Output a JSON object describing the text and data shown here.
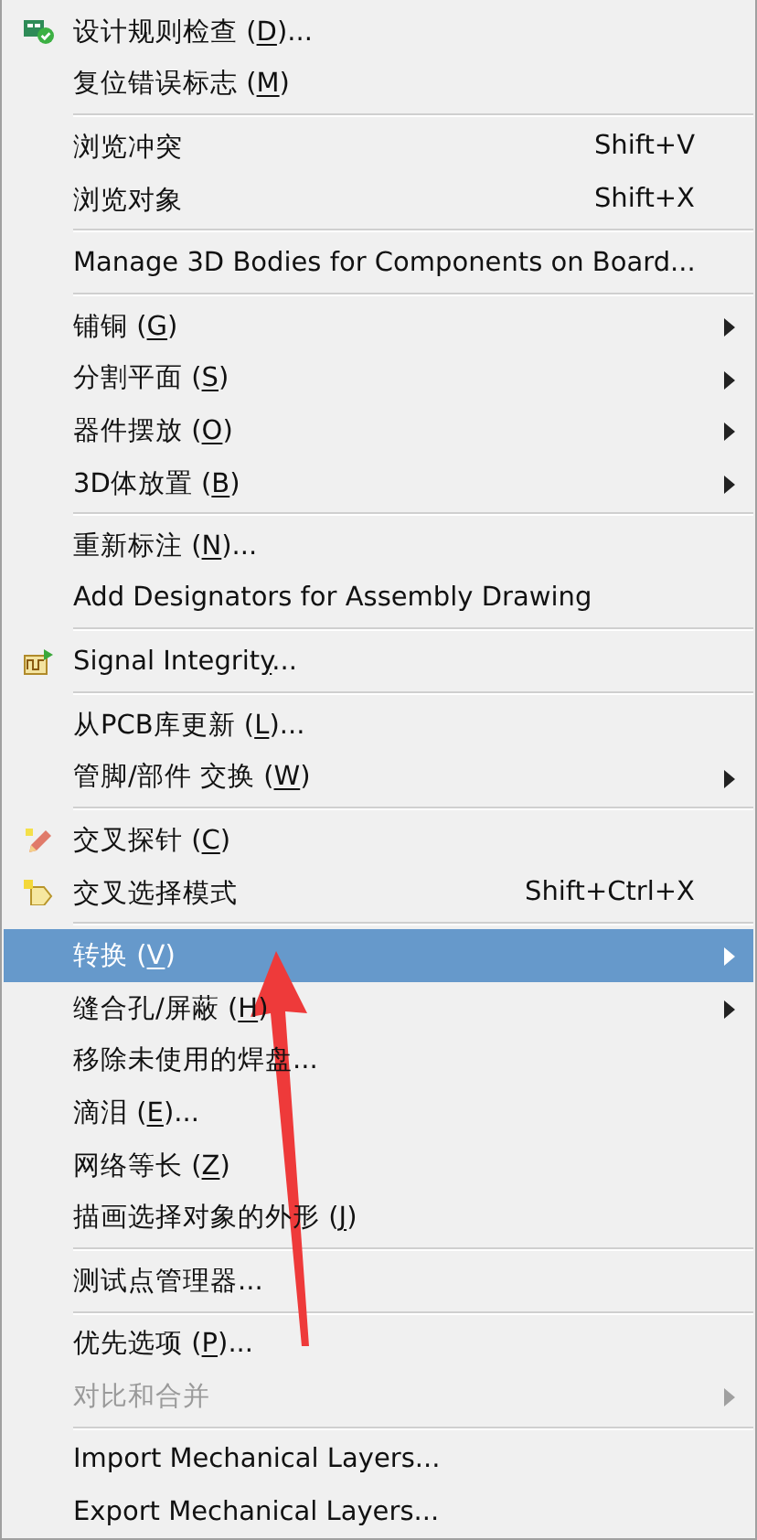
{
  "menu": {
    "groups": [
      [
        {
          "label": "设计规则检查 (",
          "key": "D",
          "rest": ")...",
          "kind": "check",
          "selected": false,
          "disabled": false,
          "submenu": false
        },
        {
          "label": "复位错误标志 (",
          "key": "M",
          "rest": ")",
          "selected": false,
          "disabled": false,
          "submenu": false
        }
      ],
      [
        {
          "label": "浏览冲突",
          "shortcut": "Shift+V",
          "selected": false,
          "disabled": false,
          "submenu": false
        },
        {
          "label": "浏览对象",
          "shortcut": "Shift+X",
          "selected": false,
          "disabled": false,
          "submenu": false
        }
      ],
      [
        {
          "label": "Manage 3D Bodies for Components on Board...",
          "selected": false,
          "disabled": false,
          "submenu": false
        }
      ],
      [
        {
          "label": "铺铜 (",
          "key": "G",
          "rest": ")",
          "selected": false,
          "disabled": false,
          "submenu": true
        },
        {
          "label": "分割平面 (",
          "key": "S",
          "rest": ")",
          "selected": false,
          "disabled": false,
          "submenu": true
        },
        {
          "label": "器件摆放 (",
          "key": "O",
          "rest": ")",
          "selected": false,
          "disabled": false,
          "submenu": true
        },
        {
          "label": "3D体放置 (",
          "key": "B",
          "rest": ")",
          "selected": false,
          "disabled": false,
          "submenu": true
        }
      ],
      [
        {
          "label": "重新标注 (",
          "key": "N",
          "rest": ")...",
          "selected": false,
          "disabled": false,
          "submenu": false
        },
        {
          "label": "Add Designators for Assembly Drawing",
          "selected": false,
          "disabled": false,
          "submenu": false
        }
      ],
      [
        {
          "label": "Signal Integrit",
          "key": "y",
          "rest": "...",
          "kind": "wave",
          "selected": false,
          "disabled": false,
          "submenu": false
        }
      ],
      [
        {
          "label": "从PCB库更新 (",
          "key": "L",
          "rest": ")...",
          "selected": false,
          "disabled": false,
          "submenu": false
        },
        {
          "label": "管脚/部件 交换 (",
          "key": "W",
          "rest": ")",
          "selected": false,
          "disabled": false,
          "submenu": true
        }
      ],
      [
        {
          "label": "交叉探针 (",
          "key": "C",
          "rest": ")",
          "kind": "pencil",
          "selected": false,
          "disabled": false,
          "submenu": false
        },
        {
          "label": "交叉选择模式",
          "shortcut": "Shift+Ctrl+X",
          "kind": "pointer",
          "selected": false,
          "disabled": false,
          "submenu": false
        }
      ],
      [
        {
          "label": "转换 (",
          "key": "V",
          "rest": ")",
          "selected": true,
          "disabled": false,
          "submenu": true
        },
        {
          "label": "缝合孔/屏蔽 (",
          "key": "H",
          "rest": ")",
          "selected": false,
          "disabled": false,
          "submenu": true
        },
        {
          "label": "移除未使用的焊盘...",
          "selected": false,
          "disabled": false,
          "submenu": false
        },
        {
          "label": "滴泪 (",
          "key": "E",
          "rest": ")...",
          "selected": false,
          "disabled": false,
          "submenu": false
        },
        {
          "label": "网络等长 (",
          "key": "Z",
          "rest": ")",
          "selected": false,
          "disabled": false,
          "submenu": false
        },
        {
          "label": "描画选择对象的外形 (",
          "key": "J",
          "rest": ")",
          "selected": false,
          "disabled": false,
          "submenu": false
        }
      ],
      [
        {
          "label": "测试点管理器...",
          "selected": false,
          "disabled": false,
          "submenu": false
        }
      ],
      [
        {
          "label": "优先选项 (",
          "key": "P",
          "rest": ")...",
          "selected": false,
          "disabled": false,
          "submenu": false
        },
        {
          "label": "对比和合并",
          "selected": false,
          "disabled": true,
          "submenu": true
        }
      ],
      [
        {
          "label": "Import Mechanical Layers...",
          "selected": false,
          "disabled": false,
          "submenu": false
        },
        {
          "label": "Export Mechanical Layers...",
          "selected": false,
          "disabled": false,
          "submenu": false
        }
      ]
    ]
  }
}
